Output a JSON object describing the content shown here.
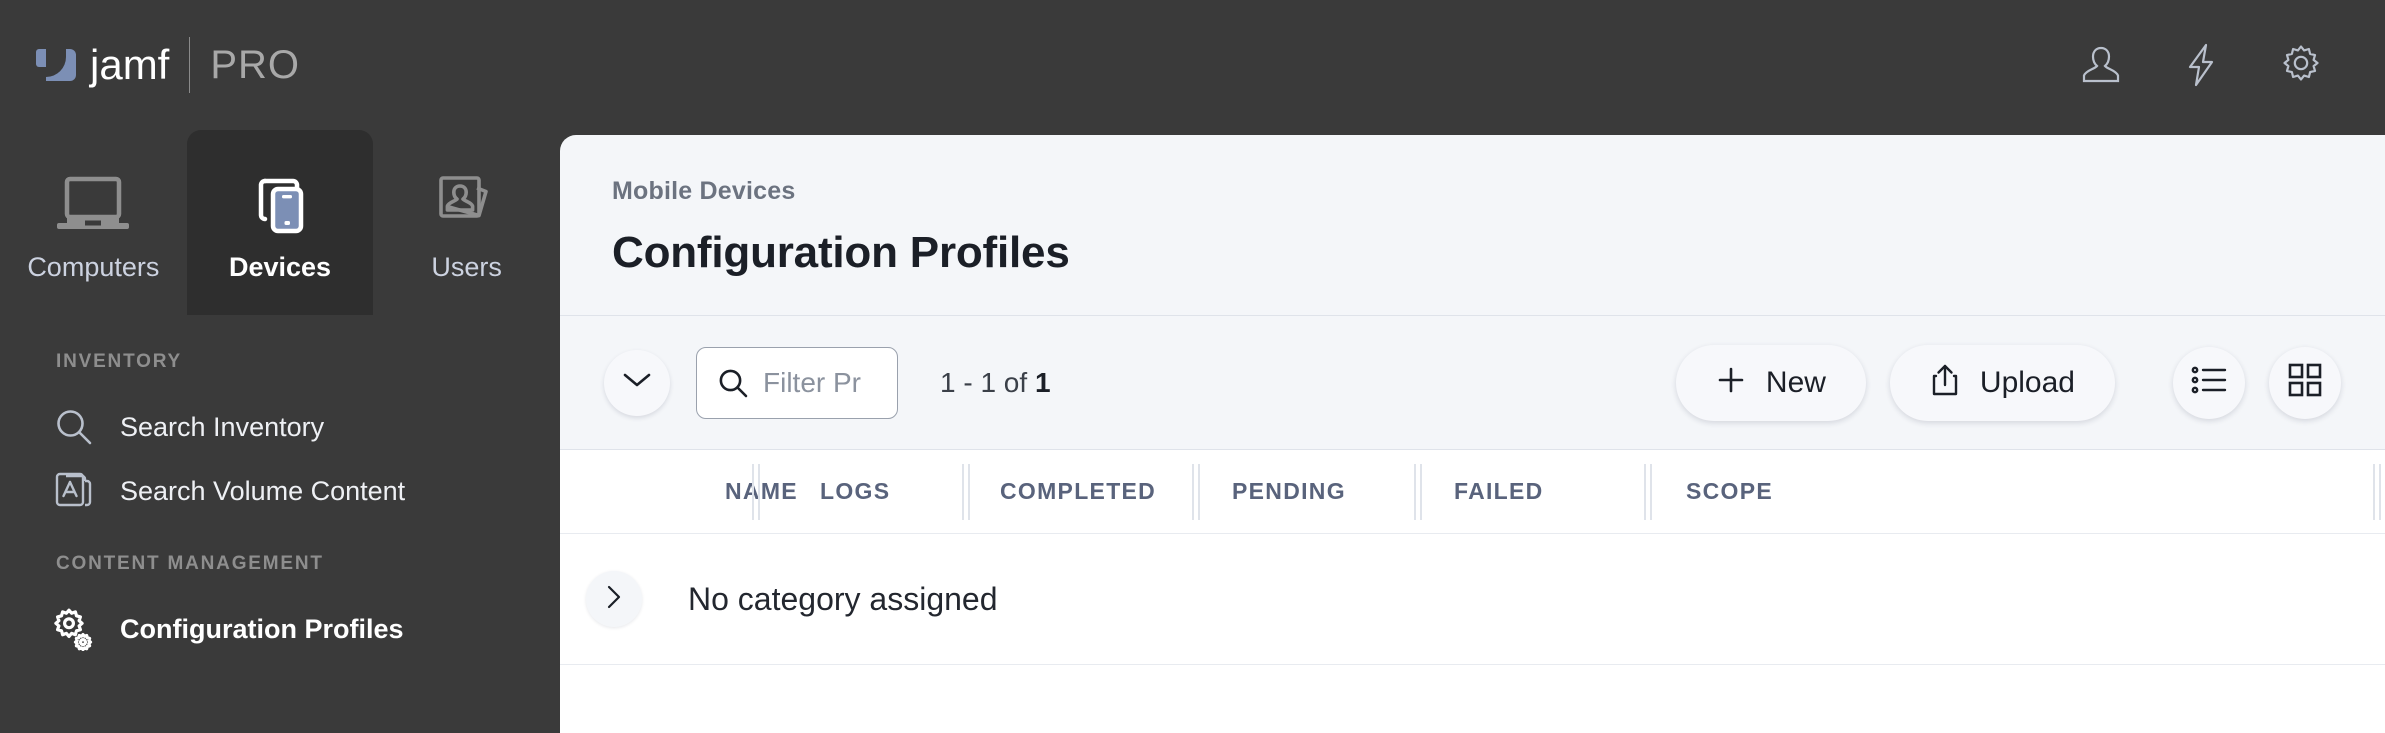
{
  "brand": {
    "name": "jamf",
    "edition": "PRO",
    "logo_color": "#7c8fb5",
    "topbar_bg": "#3a3a3a"
  },
  "topbar": {
    "icons": [
      {
        "name": "user-account-icon",
        "label": "Account"
      },
      {
        "name": "bolt-icon",
        "label": "Quick Actions"
      },
      {
        "name": "gear-settings-icon",
        "label": "Settings"
      }
    ]
  },
  "tabs": [
    {
      "id": "computers",
      "label": "Computers",
      "icon": "laptop-icon",
      "active": false
    },
    {
      "id": "devices",
      "label": "Devices",
      "icon": "mobile-devices-icon",
      "active": true
    },
    {
      "id": "users",
      "label": "Users",
      "icon": "users-cards-icon",
      "active": false
    }
  ],
  "sidebar": {
    "groups": [
      {
        "title": "INVENTORY",
        "items": [
          {
            "id": "search-inventory",
            "label": "Search Inventory",
            "icon": "magnifier-icon",
            "active": false
          },
          {
            "id": "search-volume-content",
            "label": "Search Volume Content",
            "icon": "app-store-stack-icon",
            "active": false
          }
        ]
      },
      {
        "title": "CONTENT MANAGEMENT",
        "items": [
          {
            "id": "configuration-profiles",
            "label": "Configuration Profiles",
            "icon": "gears-icon",
            "active": true
          }
        ]
      }
    ]
  },
  "main": {
    "breadcrumb": "Mobile Devices",
    "title": "Configuration Profiles",
    "accent_header_color": "#59637c",
    "panel_bg": "#f4f6f9"
  },
  "toolbar": {
    "expand_all_icon": "chevron-down-icon",
    "filter": {
      "placeholder": "Filter Pr",
      "value": "",
      "icon": "search-icon"
    },
    "count_text": "1 - 1 of ",
    "count_total": "1",
    "new_label": "New",
    "new_icon": "plus-icon",
    "upload_label": "Upload",
    "upload_icon": "upload-share-icon",
    "view_list_icon": "list-view-icon",
    "view_grid_icon": "grid-view-icon"
  },
  "table": {
    "columns": [
      {
        "id": "name",
        "label": "NAME"
      },
      {
        "id": "logs",
        "label": "LOGS"
      },
      {
        "id": "completed",
        "label": "COMPLETED"
      },
      {
        "id": "pending",
        "label": "PENDING"
      },
      {
        "id": "failed",
        "label": "FAILED"
      },
      {
        "id": "scope",
        "label": "SCOPE"
      }
    ],
    "rows": [
      {
        "id": "no-category",
        "expand_icon": "chevron-right-icon",
        "title": "No category assigned"
      }
    ]
  }
}
